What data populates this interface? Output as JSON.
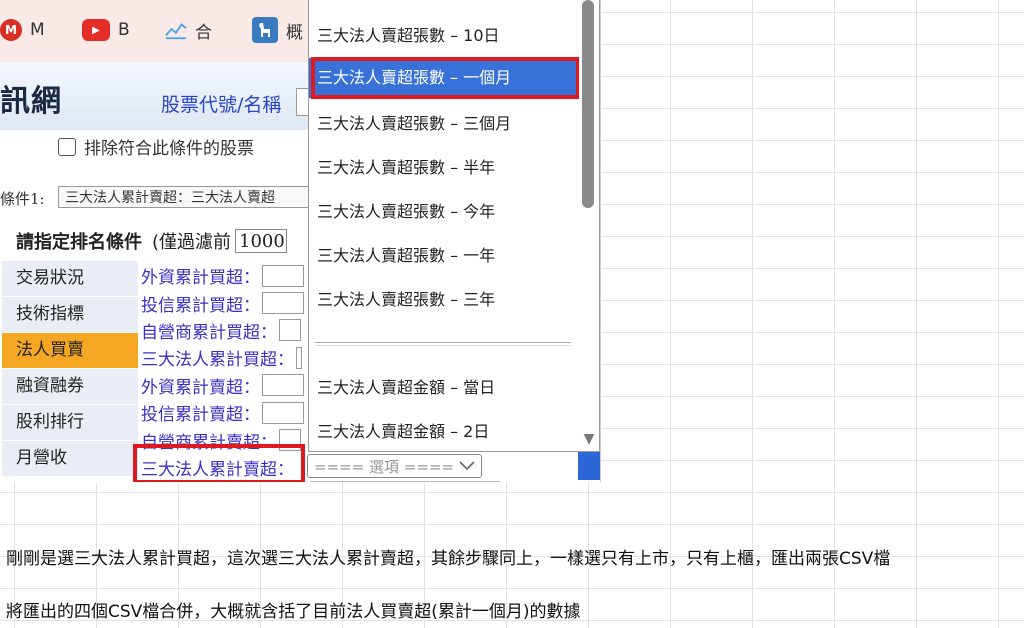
{
  "bookmarks": [
    {
      "icon": "M",
      "label": "M"
    },
    {
      "icon": "▶",
      "label": "B"
    },
    {
      "icon": "📈",
      "label": "合"
    },
    {
      "icon": "🐕",
      "label": "概"
    }
  ],
  "site": {
    "logo": "訊網",
    "stock_label": "股票代號/名稱",
    "exclude_label": "排除符合此條件的股票",
    "condition_label": "條件1:",
    "condition_value": "三大法人累計賣超：三大法人賣超"
  },
  "ranking": {
    "title": "請指定排名條件",
    "sub": "(僅過濾前",
    "count": "1000"
  },
  "categories": [
    {
      "label": "交易狀況",
      "active": false
    },
    {
      "label": "技術指標",
      "active": false
    },
    {
      "label": "法人買賣",
      "active": true
    },
    {
      "label": "融資融券",
      "active": false
    },
    {
      "label": "股利排行",
      "active": false
    },
    {
      "label": "月營收",
      "active": false
    }
  ],
  "options": [
    {
      "label": "外資累計買超："
    },
    {
      "label": "投信累計買超："
    },
    {
      "label": "自營商累計買超："
    },
    {
      "label": "三大法人累計買超："
    },
    {
      "label": "外資累計賣超："
    },
    {
      "label": "投信累計賣超："
    },
    {
      "label": "自營商累計賣超："
    },
    {
      "label": "三大法人累計賣超："
    }
  ],
  "main_select": {
    "placeholder": "==== 選項 ===="
  },
  "dropdown": {
    "items": [
      {
        "label": "三大法人賣超張數 – 10日",
        "selected": false
      },
      {
        "label": "三大法人賣超張數 – 一個月",
        "selected": true
      },
      {
        "label": "三大法人賣超張數 – 三個月",
        "selected": false
      },
      {
        "label": "三大法人賣超張數 – 半年",
        "selected": false
      },
      {
        "label": "三大法人賣超張數 – 今年",
        "selected": false
      },
      {
        "label": "三大法人賣超張數 – 一年",
        "selected": false
      },
      {
        "label": "三大法人賣超張數 – 三年",
        "selected": false
      }
    ],
    "items_b": [
      {
        "label": "三大法人賣超金額 – 當日"
      },
      {
        "label": "三大法人賣超金額 – 2日"
      }
    ]
  },
  "captions": [
    "剛剛是選三大法人累計買超，這次選三大法人累計賣超，其餘步驟同上，一樣選只有上市，只有上櫃，匯出兩張CSV檔",
    "將匯出的四個CSV檔合併，大概就含括了目前法人買賣超(累計一個月)的數據"
  ],
  "colors": {
    "accent_red": "#e01820",
    "selected_blue": "#3872d8",
    "active_tab": "#f5a623",
    "link_purple": "#3b2fc9"
  }
}
